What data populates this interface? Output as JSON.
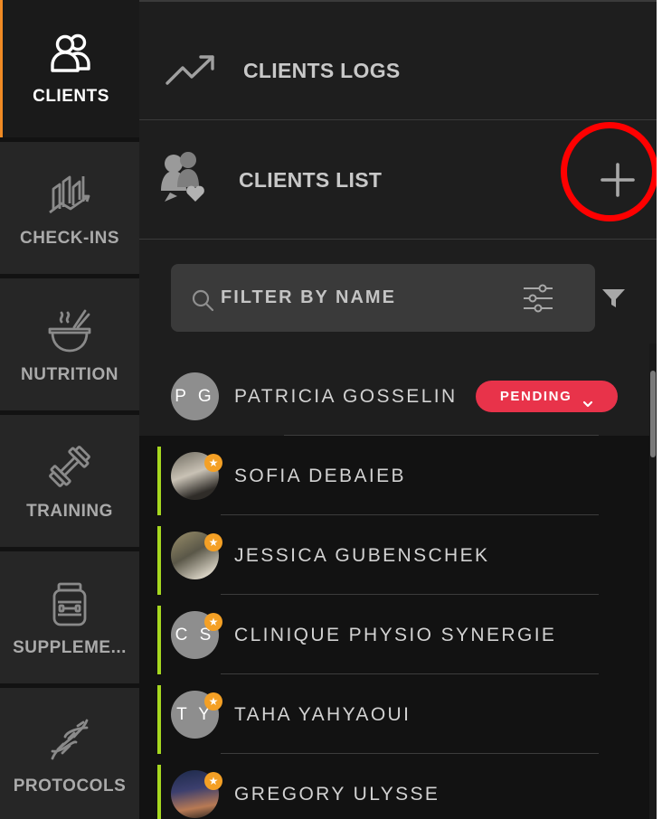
{
  "sidebar": {
    "items": [
      {
        "label": "CLIENTS",
        "icon": "users-icon",
        "active": true
      },
      {
        "label": "CHECK-INS",
        "icon": "chart-trend-icon",
        "active": false
      },
      {
        "label": "NUTRITION",
        "icon": "bowl-icon",
        "active": false
      },
      {
        "label": "TRAINING",
        "icon": "dumbbell-icon",
        "active": false
      },
      {
        "label": "SUPPLEME...",
        "icon": "supplement-jar-icon",
        "active": false
      },
      {
        "label": "PROTOCOLS",
        "icon": "dna-icon",
        "active": false
      }
    ]
  },
  "sections": {
    "logs_title": "CLIENTS LOGS",
    "list_title": "CLIENTS LIST",
    "add_icon": "plus-icon"
  },
  "search": {
    "placeholder": "FILTER BY NAME",
    "icons": [
      "search-icon",
      "sliders-icon",
      "filter-icon"
    ]
  },
  "clients": [
    {
      "initials": "P G",
      "name": "PATRICIA GOSSELIN",
      "status": "PENDING",
      "avatar": "initials",
      "starred": false
    },
    {
      "initials": "",
      "name": "SOFIA DEBAIEB",
      "avatar": "photo",
      "starred": true
    },
    {
      "initials": "",
      "name": "JESSICA GUBENSCHEK",
      "avatar": "photo",
      "starred": true
    },
    {
      "initials": "C S",
      "name": "CLINIQUE PHYSIO SYNERGIE",
      "avatar": "initials",
      "starred": true
    },
    {
      "initials": "T Y",
      "name": "TAHA YAHYAOUI",
      "avatar": "initials",
      "starred": true
    },
    {
      "initials": "",
      "name": "GREGORY ULYSSE",
      "avatar": "photo",
      "starred": true
    }
  ],
  "colors": {
    "active_accent": "#f08a24",
    "pending_badge": "#e8334a",
    "client_accent": "#a6d81f",
    "star_badge": "#f4a025",
    "highlight_ring": "#ff0000"
  }
}
